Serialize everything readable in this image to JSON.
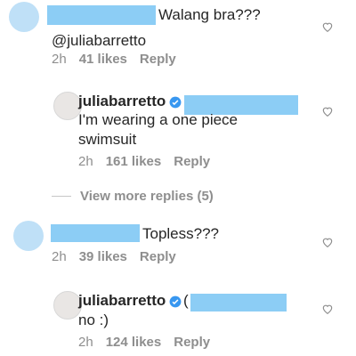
{
  "comments": [
    {
      "text": "Walang bra???",
      "mention": "@juliabarretto",
      "time": "2h",
      "likes": "41 likes",
      "reply": "Reply"
    },
    {
      "username": "juliabarretto",
      "text_line1": "I'm wearing a one piece",
      "text_line2": "swimsuit",
      "time": "2h",
      "likes": "161 likes",
      "reply": "Reply"
    },
    {
      "view_more": "View more replies (5)"
    },
    {
      "text": "Topless???",
      "time": "2h",
      "likes": "39 likes",
      "reply": "Reply"
    },
    {
      "username": "juliabarretto",
      "text_prefix": "(",
      "text": "no :)",
      "time": "2h",
      "likes": "124 likes",
      "reply": "Reply"
    }
  ],
  "icons": {
    "heart": "heart-outline-icon",
    "verified": "verified-badge-icon"
  },
  "colors": {
    "redaction": "#8ccdf5",
    "verified": "#3897f0",
    "muted": "#8e8e8e"
  }
}
